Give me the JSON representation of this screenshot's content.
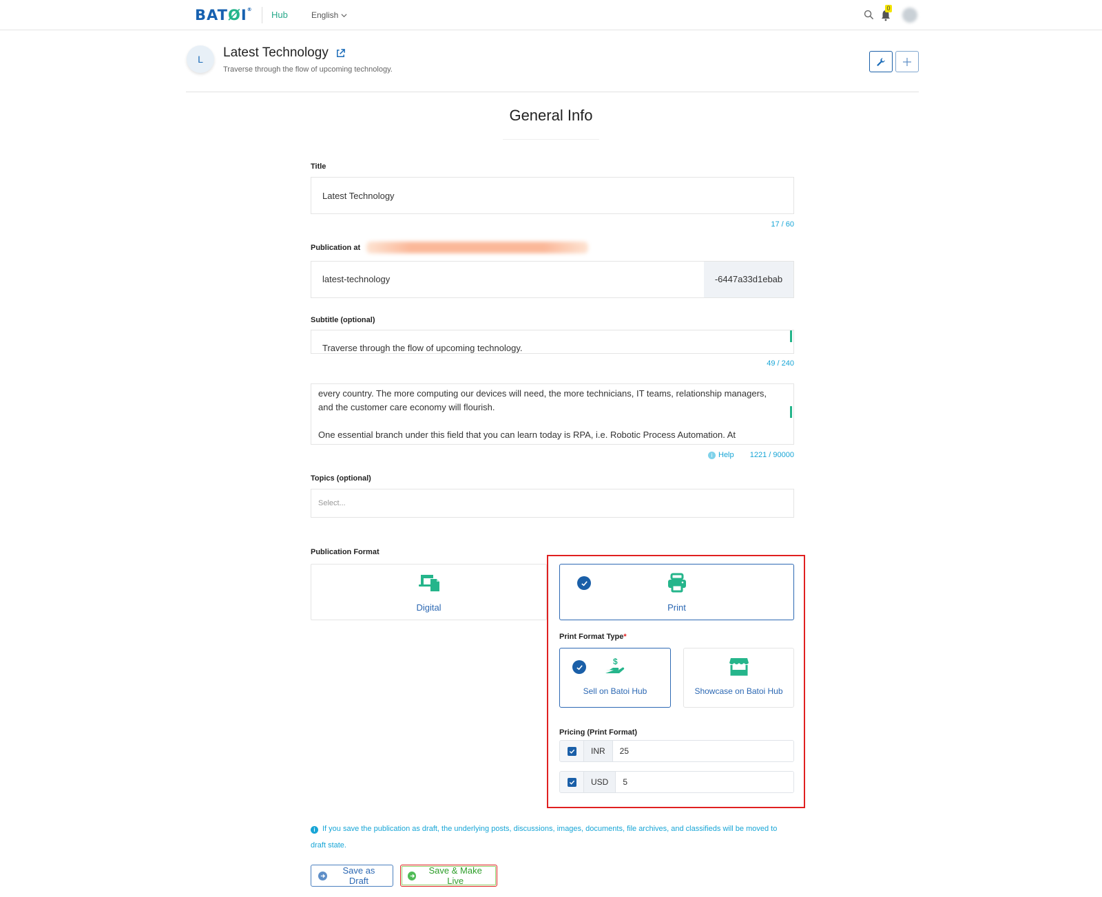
{
  "nav": {
    "logo_text": "BATOI",
    "hub_label": "Hub",
    "language": "English",
    "notification_count": "0"
  },
  "publication": {
    "avatar_letter": "L",
    "title": "Latest Technology",
    "description": "Traverse through the flow of upcoming technology."
  },
  "section_title": "General Info",
  "form": {
    "title_label": "Title",
    "title_value": "Latest Technology",
    "title_counter": "17 / 60",
    "publication_at_label": "Publication at",
    "slug_value": "latest-technology",
    "slug_suffix": "-6447a33d1ebab",
    "subtitle_label": "Subtitle (optional)",
    "subtitle_value": "Traverse through the flow of upcoming technology.",
    "subtitle_counter": "49 / 240",
    "body_lines": [
      "every country. The more computing our devices will need, the more technicians, IT teams, relationship managers,",
      "and the customer care economy will flourish.",
      "",
      "One essential branch under this field that you can learn today is RPA, i.e. Robotic Process Automation. At"
    ],
    "help_label": "Help",
    "body_counter": "1221 / 90000",
    "topics_label": "Topics (optional)",
    "topics_placeholder": "Select..."
  },
  "publication_format": {
    "label": "Publication Format",
    "options": [
      {
        "label": "Digital",
        "icon": "devices-icon",
        "selected": false
      },
      {
        "label": "Print",
        "icon": "printer-icon",
        "selected": true
      }
    ]
  },
  "print_format_type": {
    "label": "Print Format Type",
    "required_marker": "*",
    "options": [
      {
        "label": "Sell on Batoi Hub",
        "icon": "hand-dollar-icon",
        "selected": true
      },
      {
        "label": "Showcase on Batoi Hub",
        "icon": "storefront-icon",
        "selected": false
      }
    ]
  },
  "pricing": {
    "label": "Pricing (Print Format)",
    "rows": [
      {
        "currency": "INR",
        "value": "25",
        "checked": true
      },
      {
        "currency": "USD",
        "value": "5",
        "checked": true
      }
    ]
  },
  "notice": "If you save the publication as draft, the underlying posts, discussions, images, documents, file archives, and classifieds will be moved to draft state.",
  "actions": {
    "save_draft": "Save as Draft",
    "save_live": "Save & Make Live"
  },
  "colors": {
    "brand_blue": "#1a5fa8",
    "accent_green": "#25b58b",
    "info_cyan": "#17a5d6",
    "highlight_red": "#e02020"
  }
}
